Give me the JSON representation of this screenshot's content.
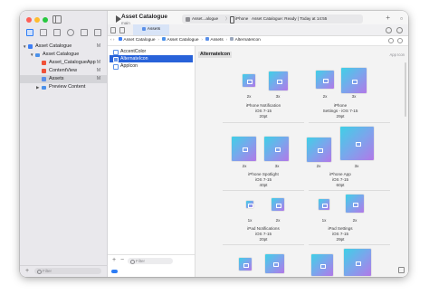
{
  "project": {
    "title": "Asset Catalogue",
    "subtitle": "main"
  },
  "status": {
    "scheme": "Asset...alogue",
    "device": "iPhone",
    "message": "Asset Catalogue: Ready | Today at 14:55"
  },
  "tab": {
    "label": "Assets"
  },
  "breadcrumb": [
    "Asset Catalogue",
    "Asset Catalogue",
    "Assets",
    "AlternateIcon"
  ],
  "navigator": {
    "items": [
      {
        "label": "Asset Catalogue",
        "badge": "M",
        "icon": "project-icon",
        "depth": 0,
        "expanded": true
      },
      {
        "label": "Asset Catalogue",
        "badge": "",
        "icon": "folder-icon",
        "depth": 1,
        "expanded": true
      },
      {
        "label": "Asset_CatalogueApp",
        "badge": "M",
        "icon": "swift-file-icon",
        "depth": 2
      },
      {
        "label": "ContentView",
        "badge": "M",
        "icon": "swift-file-icon",
        "depth": 2
      },
      {
        "label": "Assets",
        "badge": "M",
        "icon": "asset-catalog-icon",
        "depth": 2,
        "selected": true
      },
      {
        "label": "Preview Content",
        "badge": "",
        "icon": "folder-icon",
        "depth": 2,
        "expanded": false
      }
    ],
    "filter_placeholder": "Filter"
  },
  "assets": {
    "items": [
      {
        "label": "AccentColor",
        "selected": false
      },
      {
        "label": "AlternateIcon",
        "selected": true
      },
      {
        "label": "AppIcon",
        "selected": false
      }
    ],
    "filter_placeholder": "Filter"
  },
  "detail": {
    "title": "AlternateIcon",
    "right_label": "App Icon",
    "groups": [
      {
        "lines": [
          "iPhone Notification",
          "iOS 7-15",
          "20pt"
        ],
        "scales": [
          "2x",
          "3x"
        ]
      },
      {
        "lines": [
          "iPhone",
          "Settings - iOS 7-15",
          "29pt"
        ],
        "scales": [
          "2x",
          "3x"
        ]
      },
      {
        "lines": [
          "iPhone Spotlight",
          "iOS 7-15",
          "40pt"
        ],
        "scales": [
          "2x",
          "3x"
        ]
      },
      {
        "lines": [
          "iPhone App",
          "iOS 7-15",
          "60pt"
        ],
        "scales": [
          "2x",
          "3x"
        ]
      },
      {
        "lines": [
          "iPad Notifications",
          "iOS 7-15",
          "20pt"
        ],
        "scales": [
          "1x",
          "2x"
        ]
      },
      {
        "lines": [
          "iPad Settings",
          "iOS 7-15",
          "29pt"
        ],
        "scales": [
          "1x",
          "2x"
        ]
      },
      {
        "lines": [],
        "scales": []
      },
      {
        "lines": [],
        "scales": []
      }
    ]
  },
  "colors": {
    "accent": "#2862d9",
    "icon_gradient_start": "#3fd0e6",
    "icon_gradient_end": "#b278e8"
  }
}
